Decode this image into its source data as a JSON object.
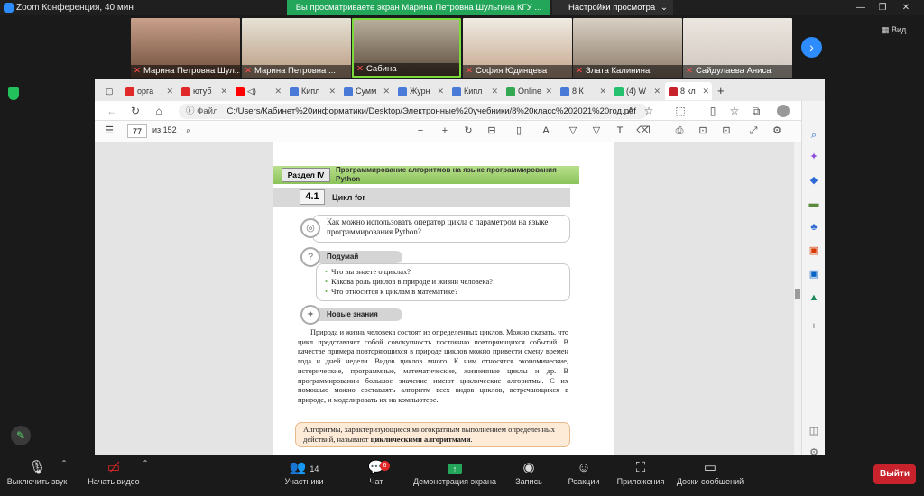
{
  "titlebar": {
    "title": "Zoom Конференция, 40 мин"
  },
  "share_banner": {
    "text": "Вы просматриваете экран Марина Петровна Шульгина  КГУ ..."
  },
  "view_settings": {
    "label": "Настройки просмотра"
  },
  "view_label": "Вид",
  "participants": [
    {
      "name": "Марина Петровна Шул..."
    },
    {
      "name": "Марина Петровна ..."
    },
    {
      "name": "Сабина"
    },
    {
      "name": "София Юдинцева"
    },
    {
      "name": "Злата Калинина"
    },
    {
      "name": "Сайдулаева Аниса"
    }
  ],
  "browser": {
    "tabs": [
      {
        "label": "орга"
      },
      {
        "label": "ютуб"
      },
      {
        "label": ""
      },
      {
        "label": "Кипл"
      },
      {
        "label": "Сумм"
      },
      {
        "label": "Журн"
      },
      {
        "label": "Кипл"
      },
      {
        "label": "Online"
      },
      {
        "label": "8 К"
      },
      {
        "label": "(4) W"
      },
      {
        "label": "8 кл"
      }
    ],
    "address_label": "Файл",
    "url": "C:/Users/Кабинет%20информатики/Desktop/Электронные%20учебники/8%20класс%202021%20год.pdf",
    "pdf": {
      "page_number": "77",
      "page_total": "из 152"
    }
  },
  "pdfpage": {
    "section_label": "Раздел IV",
    "section_title": "Программирование алгоритмов на языке программирования Python",
    "lesson_number": "4.1",
    "lesson_title": "Цикл for",
    "question": "Как можно использовать оператор цикла с параметром на языке программирования Python?",
    "think_label": "Подумай",
    "think_items": [
      "Что вы знаете о циклах?",
      "Какова роль циклов в природе и жизни человека?",
      "Что относится к циклам в математике?"
    ],
    "new_label": "Новые знания",
    "body": "Природа и жизнь человека состоят из определенных циклов. Можно сказать, что цикл представляет собой совокупность постоянно повторяющихся событий. В качестве примера повторяющихся в природе циклов можно привести смену времен года и дней недели. Видов циклов много. К ним относятся экономические, исторические, программные, математические, жизненные циклы и др. В программировании большое значение имеют циклические алгоритмы. С их помощью можно составлять алгоритм всех видов циклов, встречающихся в природе, и моделировать их на компьютере.",
    "definition_prefix": "Алгоритмы, характеризующиеся многократным выполнением определенных действий, называют ",
    "definition_term": "циклическими алгоритмами",
    "definition_suffix": "."
  },
  "toolbar": {
    "mute_label": "Выключить звук",
    "video_label": "Начать видео",
    "participants_label": "Участники",
    "participants_count": "14",
    "chat_label": "Чат",
    "chat_badge": "6",
    "share_label": "Демонстрация экрана",
    "record_label": "Запись",
    "reactions_label": "Реакции",
    "apps_label": "Приложения",
    "boards_label": "Доски сообщений",
    "leave_label": "Выйти"
  },
  "colors": {
    "share_green": "#23a55a",
    "leave_red": "#c8232c",
    "zoom_blue": "#2d8cff"
  }
}
